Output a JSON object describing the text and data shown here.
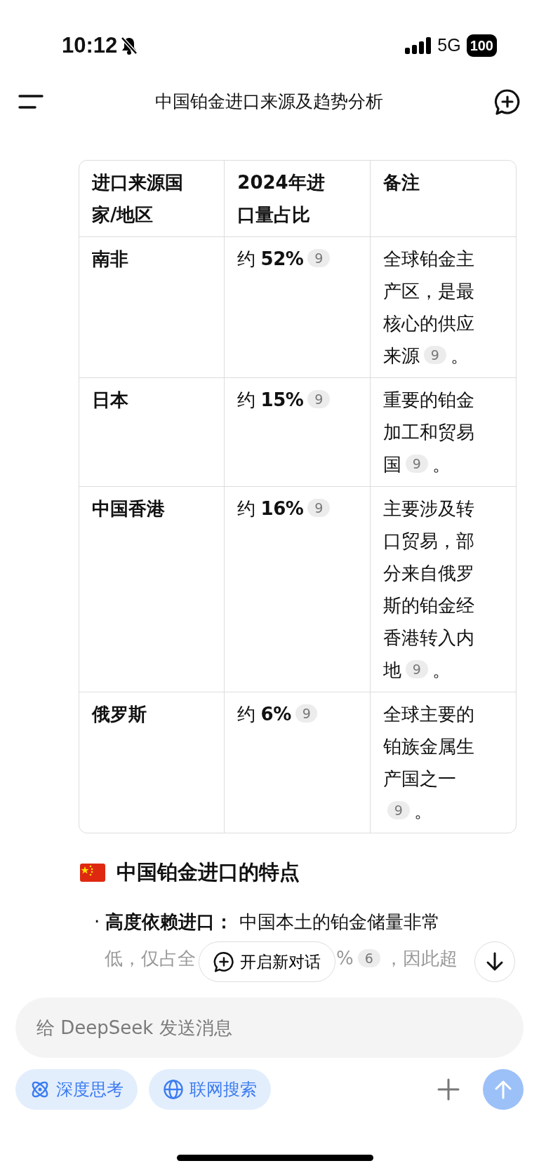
{
  "status_bar": {
    "time": "10:12",
    "network": "5G",
    "battery": "100"
  },
  "header": {
    "title": "中国铂金进口来源及趋势分析"
  },
  "table": {
    "columns": [
      "进口来源国家/地区",
      "2024年进口量占比",
      "备注"
    ],
    "rows": [
      {
        "cells": [
          "南非",
          "约 **52%**",
          "全球铂金主产区，是最核心的供应来源"
        ],
        "share_cite": "9",
        "cite": "9",
        "tail": "。"
      },
      {
        "cells": [
          "日本",
          "约 **15%**",
          "重要的铂金加工和贸易国"
        ],
        "share_cite": "9",
        "cite": "9",
        "tail": "。"
      },
      {
        "cells": [
          "中国香港",
          "约 **16%**",
          "主要涉及转口贸易，部分来自俄罗斯的铂金经香港转入内地"
        ],
        "share_cite": "9",
        "cite": "9",
        "tail": "。"
      },
      {
        "cells": [
          "俄罗斯",
          "约 **6%**",
          "全球主要的铂族金属生产国之一"
        ],
        "share_cite": "9",
        "cite": "9",
        "tail": "。"
      }
    ]
  },
  "section": {
    "heading": "中国铂金进口的特点"
  },
  "bullet": {
    "marker": "·",
    "label": "高度依赖进口：",
    "text": "中国本土的铂金储量非常",
    "line2_parts": [
      "低，仅占全",
      "%"
    ],
    "line2_cite": "6",
    "line2_tail": "，因此超"
  },
  "new_chat_button": {
    "label": "开启新对话"
  },
  "composer": {
    "placeholder": "给 DeepSeek 发送消息",
    "toggles": [
      {
        "kind": "think",
        "label": "深度思考",
        "selected": false
      },
      {
        "kind": "search",
        "label": "联网搜索",
        "selected": false
      }
    ],
    "send_enabled": false
  }
}
